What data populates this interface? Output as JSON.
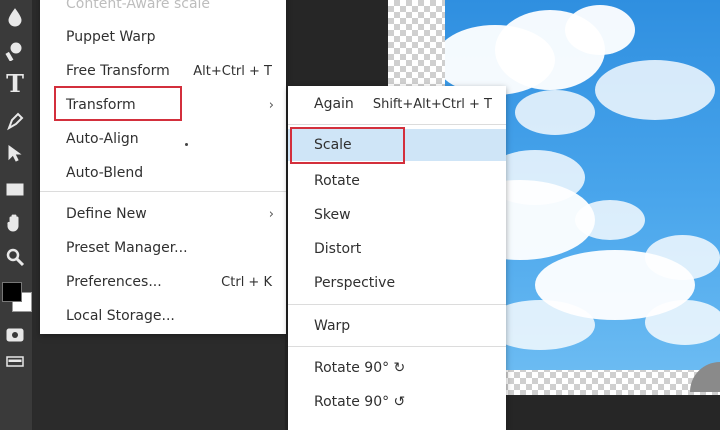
{
  "main_menu": {
    "items": [
      {
        "label": "Content-Aware scale",
        "shortcut": "",
        "has_submenu": false,
        "disabled": true
      },
      {
        "label": "Puppet Warp",
        "shortcut": "",
        "has_submenu": false
      },
      {
        "label": "Free Transform",
        "shortcut": "Alt+Ctrl + T",
        "has_submenu": false
      },
      {
        "label": "Transform",
        "shortcut": "",
        "has_submenu": true,
        "outlined": true
      },
      {
        "label": "Auto-Align",
        "shortcut": "",
        "has_submenu": false
      },
      {
        "label": "Auto-Blend",
        "shortcut": "",
        "has_submenu": false
      },
      {
        "label": "Define New",
        "shortcut": "",
        "has_submenu": true
      },
      {
        "label": "Preset Manager...",
        "shortcut": "",
        "has_submenu": false
      },
      {
        "label": "Preferences...",
        "shortcut": "Ctrl + K",
        "has_submenu": false
      },
      {
        "label": "Local Storage...",
        "shortcut": "",
        "has_submenu": false
      }
    ],
    "submenu_arrow": "›"
  },
  "transform_submenu": {
    "items": [
      {
        "label": "Again",
        "shortcut": "Shift+Alt+Ctrl + T"
      },
      {
        "label": "Scale",
        "shortcut": "",
        "highlighted": true,
        "outlined": true
      },
      {
        "label": "Rotate",
        "shortcut": ""
      },
      {
        "label": "Skew",
        "shortcut": ""
      },
      {
        "label": "Distort",
        "shortcut": ""
      },
      {
        "label": "Perspective",
        "shortcut": ""
      },
      {
        "label": "Warp",
        "shortcut": ""
      },
      {
        "label": "Rotate 90° ↻",
        "shortcut": ""
      },
      {
        "label": "Rotate 90° ↺",
        "shortcut": ""
      }
    ]
  },
  "toolbar": {
    "tools": [
      "drop-icon",
      "quick-selection-icon",
      "type-icon",
      "pen-icon",
      "path-select-icon",
      "rectangle-icon",
      "hand-icon",
      "zoom-icon",
      "color-swatch-icon",
      "quick-mask-icon",
      "screen-mode-icon"
    ],
    "type_glyph": "T"
  },
  "colors": {
    "menu_bg": "#ffffff",
    "highlight": "#cfe5f7",
    "annotation_red": "#d32f3c",
    "toolbar_bg": "#3a3a3a",
    "sky": "#3d9be6"
  }
}
